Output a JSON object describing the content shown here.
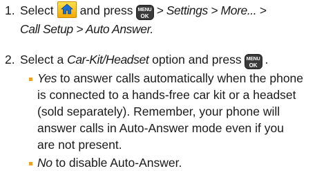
{
  "step1": {
    "number": "1.",
    "text_before": "Select",
    "text_mid": "and press",
    "path_line1": "> Settings > More... >",
    "path_line2": "Call Setup > Auto Answer."
  },
  "step2": {
    "number": "2.",
    "text_before": "Select a",
    "option_name": "Car-Kit/Headset",
    "text_after": "option and press"
  },
  "bullets": [
    {
      "term": "Yes",
      "line1": "to answer calls automatically when the phone",
      "line2": "is connected to a hands-free car kit or a headset",
      "line3": "(sold separately). Remember, your phone will",
      "line4": "answer calls in Auto-Answer mode even if you",
      "line5": "are not present."
    },
    {
      "term": "No",
      "line1": "to disable Auto-Answer."
    }
  ],
  "icons": {
    "home": "home-icon",
    "menu_ok": {
      "top": "MENU",
      "bottom": "OK"
    }
  },
  "colors": {
    "bullet": "#f0a020",
    "home_icon": "#f5b800"
  }
}
